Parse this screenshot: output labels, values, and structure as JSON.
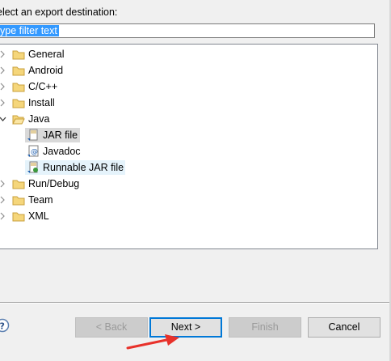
{
  "dialog": {
    "instruction": "elect an export destination:",
    "filter_placeholder": "ype filter text"
  },
  "tree": {
    "items": [
      {
        "label": "General",
        "expanded": false,
        "icon": "folder-icon"
      },
      {
        "label": "Android",
        "expanded": false,
        "icon": "folder-icon"
      },
      {
        "label": "C/C++",
        "expanded": false,
        "icon": "folder-icon"
      },
      {
        "label": "Install",
        "expanded": false,
        "icon": "folder-icon"
      },
      {
        "label": "Java",
        "expanded": true,
        "icon": "folder-open-icon",
        "children": [
          {
            "label": "JAR file",
            "icon": "jar-file-icon",
            "selected": true
          },
          {
            "label": "Javadoc",
            "icon": "javadoc-icon"
          },
          {
            "label": "Runnable JAR file",
            "icon": "runnable-jar-icon",
            "hovered": true
          }
        ]
      },
      {
        "label": "Run/Debug",
        "expanded": false,
        "icon": "folder-icon"
      },
      {
        "label": "Team",
        "expanded": false,
        "icon": "folder-icon"
      },
      {
        "label": "XML",
        "expanded": false,
        "icon": "folder-icon"
      }
    ]
  },
  "buttons": {
    "back": "< Back",
    "next": "Next >",
    "finish": "Finish",
    "cancel": "Cancel"
  },
  "colors": {
    "selection": "#3399ff",
    "default_button_border": "#0078d7",
    "annotation_arrow": "#e8312a",
    "folder": "#e8c25a"
  }
}
